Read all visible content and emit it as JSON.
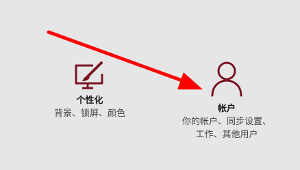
{
  "colors": {
    "background": "#e6e6e6",
    "icon_accent": "#7a1522",
    "annotation_arrow": "#ff0000"
  },
  "tiles": [
    {
      "icon": "paintbrush-monitor-icon",
      "title": "个性化",
      "description_lines": [
        "背景、锁屏、颜色"
      ]
    },
    {
      "icon": "user-icon",
      "title": "帐户",
      "description_lines": [
        "你的帐户、同步设置、",
        "工作、其他用户"
      ]
    }
  ]
}
